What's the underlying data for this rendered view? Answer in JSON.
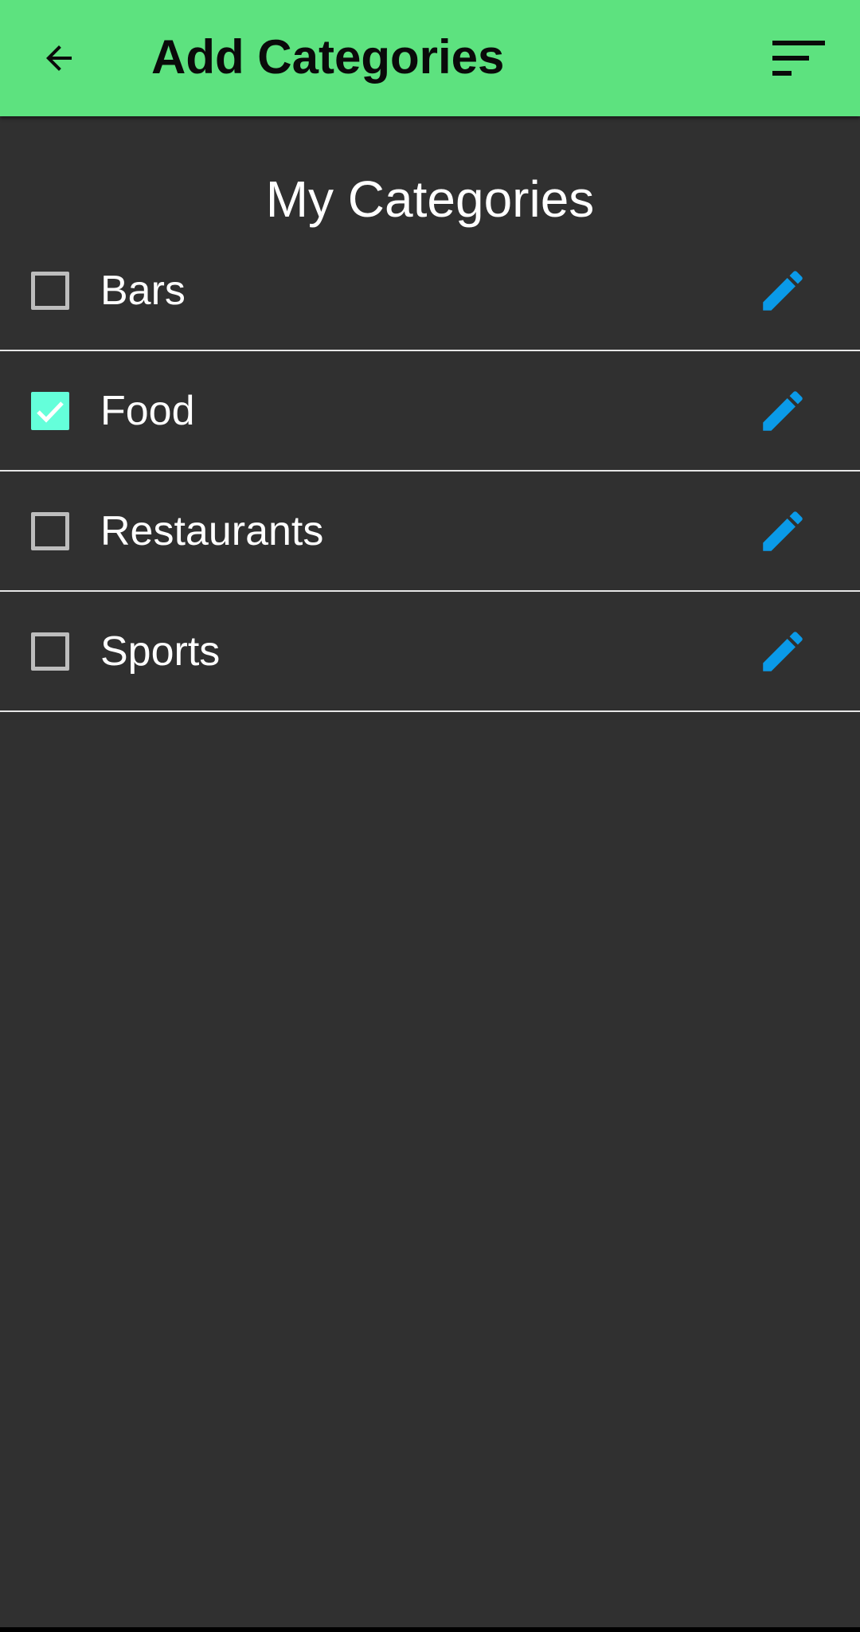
{
  "app_bar": {
    "title": "Add Categories",
    "back_icon": "arrow-left-icon",
    "sort_icon": "sort-icon",
    "background": "#5de27f"
  },
  "section": {
    "title": "My Categories"
  },
  "categories": [
    {
      "label": "Bars",
      "checked": false
    },
    {
      "label": "Food",
      "checked": true
    },
    {
      "label": "Restaurants",
      "checked": false
    },
    {
      "label": "Sports",
      "checked": false
    }
  ],
  "colors": {
    "background": "#303030",
    "checkbox_checked": "#64ffda",
    "checkbox_unchecked": "#bdbdbd",
    "edit_icon": "#0a9ae8",
    "divider": "#e6e6e6"
  },
  "icons": {
    "edit": "pencil-icon",
    "check": "check-icon"
  }
}
